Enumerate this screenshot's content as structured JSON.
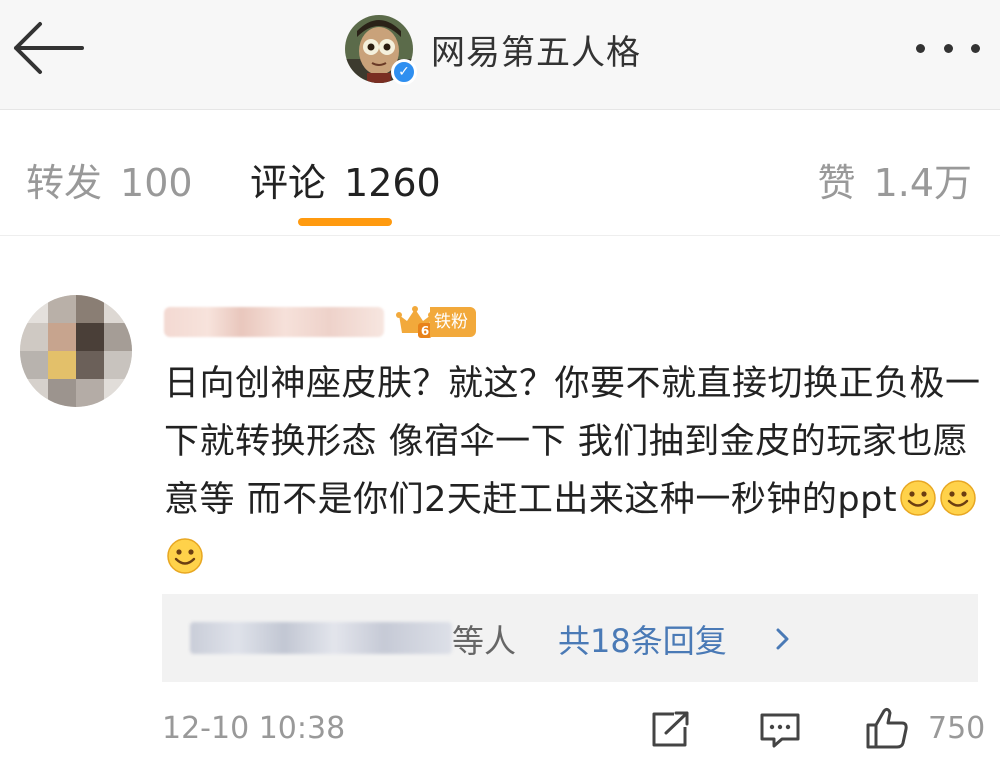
{
  "header": {
    "account_name": "网易第五人格",
    "back_icon": "arrow-left-icon",
    "more_icon": "more-dots-icon",
    "verified_icon": "verified-check-icon"
  },
  "tabs": [
    {
      "label": "转发",
      "count": "100"
    },
    {
      "label": "评论",
      "count": "1260",
      "active": true
    },
    {
      "label": "赞",
      "count": "1.4万"
    }
  ],
  "colors": {
    "accent": "#ff9a0f",
    "link": "#4a7ab6",
    "badge": "#f2a93b",
    "verified": "#2f8ff0"
  },
  "comment": {
    "badge_level": "6",
    "badge_text": "铁粉",
    "text": "日向创神座皮肤？就这？你要不就直接切换正负极一下就转换形态 像宿伞一下 我们抽到金皮的玩家也愿意等 而不是你们2天赶工出来这种一秒钟的ppt",
    "emoji_icon": "smile-emoji-icon",
    "emoji_count": 3,
    "replies": {
      "others_suffix": "等人",
      "count_text": "共18条回复"
    },
    "time": "12-10 10:38",
    "like_count": "750"
  }
}
